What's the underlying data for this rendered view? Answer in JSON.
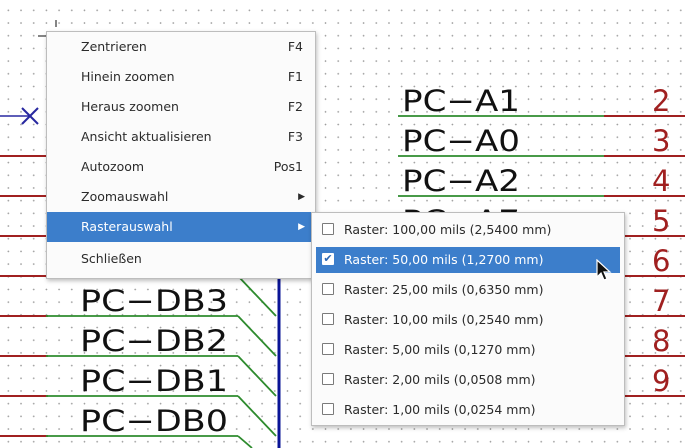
{
  "schematic": {
    "labels_right": [
      "PC−A1",
      "PC−A0",
      "PC−A2",
      "PC−A7"
    ],
    "labels_left": [
      "PC−DB3",
      "PC−DB2",
      "PC−DB1",
      "PC−DB0"
    ],
    "pin_numbers": [
      "2",
      "3",
      "4",
      "5",
      "6",
      "7",
      "8",
      "9"
    ],
    "colors": {
      "wire": "#2e8b2e",
      "bus": "#0a1496",
      "pin": "#a02020",
      "pin_number": "#a02020",
      "label_text": "#111111",
      "no_connect": "#2828a0"
    }
  },
  "context_menu": {
    "items": [
      {
        "label": "Zentrieren",
        "shortcut": "F4"
      },
      {
        "label": "Hinein zoomen",
        "shortcut": "F1"
      },
      {
        "label": "Heraus zoomen",
        "shortcut": "F2"
      },
      {
        "label": "Ansicht aktualisieren",
        "shortcut": "F3"
      },
      {
        "label": "Autozoom",
        "shortcut": "Pos1"
      },
      {
        "label": "Zoomauswahl",
        "shortcut": "▶"
      },
      {
        "label": "Rasterauswahl",
        "shortcut": "▶",
        "active": true
      },
      {
        "label": "Schließen",
        "shortcut": ""
      }
    ]
  },
  "grid_submenu": {
    "items": [
      {
        "label": "Raster: 100,00 mils (2,5400 mm)",
        "checked": false
      },
      {
        "label": "Raster: 50,00 mils (1,2700 mm)",
        "checked": true
      },
      {
        "label": "Raster: 25,00 mils (0,6350 mm)",
        "checked": false
      },
      {
        "label": "Raster: 10,00 mils (0,2540 mm)",
        "checked": false
      },
      {
        "label": "Raster: 5,00 mils (0,1270 mm)",
        "checked": false
      },
      {
        "label": "Raster: 2,00 mils (0,0508 mm)",
        "checked": false
      },
      {
        "label": "Raster: 1,00 mils (0,0254 mm)",
        "checked": false
      }
    ],
    "check_glyph": "✔"
  }
}
